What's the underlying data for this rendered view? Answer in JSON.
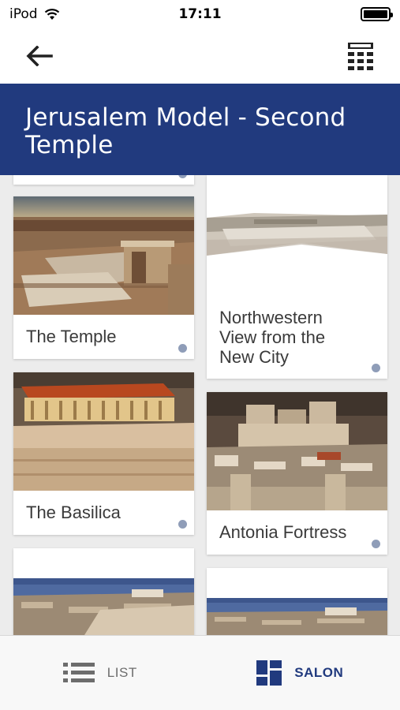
{
  "status_bar": {
    "carrier": "iPod",
    "time": "17:11"
  },
  "nav": {
    "back_icon": "arrow-left-icon",
    "view_icon": "calculator-grid-icon"
  },
  "page": {
    "title": "Jerusalem Model - Second Temple"
  },
  "items": [
    {
      "caption": "The Temple"
    },
    {
      "caption": "Northwestern View from the New City"
    },
    {
      "caption": "The Basilica"
    },
    {
      "caption": "Antonia Fortress"
    },
    {
      "caption": ""
    },
    {
      "caption": ""
    }
  ],
  "tab_bar": {
    "list_label": "LIST",
    "salon_label": "SALON",
    "list_icon": "list-icon",
    "salon_icon": "salon-grid-icon",
    "active": "SALON"
  },
  "colors": {
    "brand_blue": "#213a7e",
    "dot": "#8f9db8",
    "inactive": "#6d6d6d"
  }
}
